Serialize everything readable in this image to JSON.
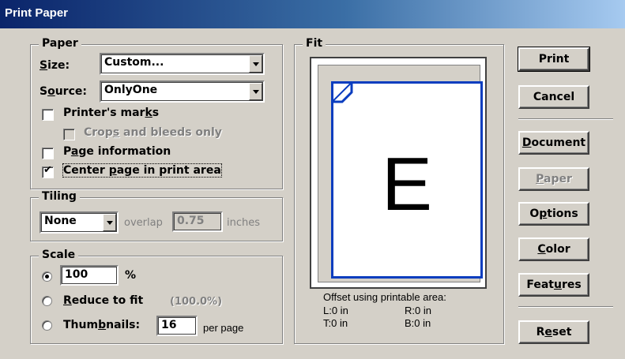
{
  "window": {
    "title": "Print Paper"
  },
  "paper": {
    "legend": "Paper",
    "size_label": "Size:",
    "size_value": "Custom...",
    "source_label": "Source:",
    "source_value": "OnlyOne",
    "printers_marks": {
      "label": "Printer's marks",
      "checked": false
    },
    "crops_bleeds": {
      "label": "Crops and bleeds only",
      "checked": false,
      "disabled": true
    },
    "page_info": {
      "label": "Page information",
      "checked": false
    },
    "center_page": {
      "label": "Center page in print area",
      "checked": true
    }
  },
  "tiling": {
    "legend": "Tiling",
    "mode": "None",
    "overlap_label": "overlap",
    "overlap_value": "0.75",
    "units": "inches"
  },
  "scale": {
    "legend": "Scale",
    "percent_value": "100",
    "percent_sign": "%",
    "reduce_label": "Reduce to fit",
    "reduce_value": "(100.0%)",
    "thumbnails_label": "Thumbnails:",
    "thumbnails_value": "16",
    "per_page": "per page",
    "selected": "percent"
  },
  "fit": {
    "legend": "Fit",
    "preview_letter": "E",
    "offset_title": "Offset using printable area:",
    "left": "L:0 in",
    "right": "R:0 in",
    "top": "T:0 in",
    "bottom": "B:0 in"
  },
  "buttons": {
    "print": "Print",
    "cancel": "Cancel",
    "document": "Document",
    "paper": "Paper",
    "options": "Options",
    "color": "Color",
    "features": "Features",
    "reset": "Reset"
  },
  "colors": {
    "title_start": "#0a246a",
    "title_end": "#a6caf0",
    "page_border": "#0a3dbf",
    "face": "#d4d0c8"
  }
}
